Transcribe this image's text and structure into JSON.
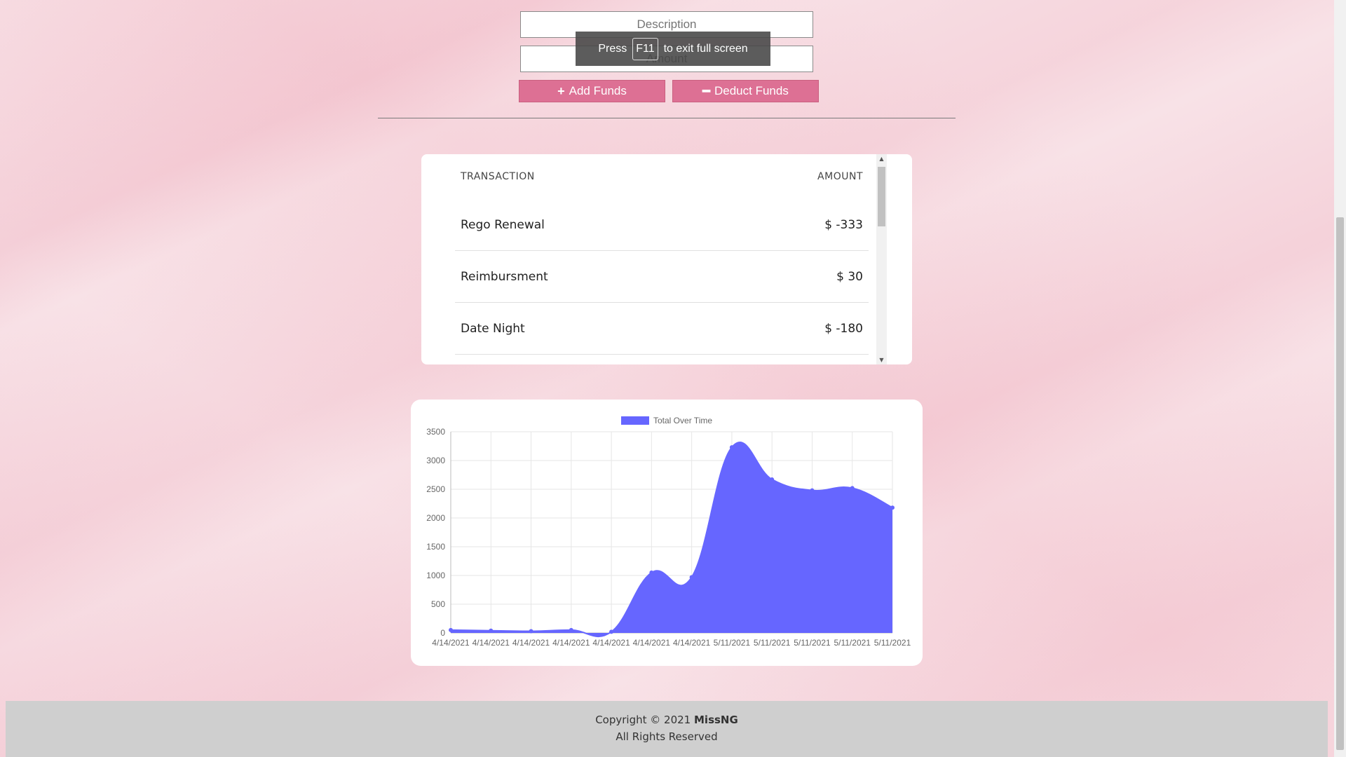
{
  "form": {
    "description_placeholder": "Description",
    "amount_placeholder": "Amount",
    "add_label": "Add Funds",
    "deduct_label": "Deduct Funds",
    "add_icon": "plus-icon",
    "deduct_icon": "minus-icon"
  },
  "fullscreen_notice": {
    "before": "Press",
    "key": "F11",
    "after": "to exit full screen"
  },
  "transactions": {
    "header": {
      "name": "TRANSACTION",
      "amount": "AMOUNT"
    },
    "rows": [
      {
        "name": "Rego Renewal",
        "amount": "$ -333"
      },
      {
        "name": "Reimbursment",
        "amount": "$ 30"
      },
      {
        "name": "Date Night",
        "amount": "$ -180"
      }
    ]
  },
  "chart_data": {
    "type": "area",
    "legend": [
      "Total Over Time"
    ],
    "series": [
      {
        "name": "Total Over Time",
        "color": "#6666ff",
        "values": [
          50,
          40,
          30,
          50,
          20,
          1050,
          970,
          3230,
          2670,
          2480,
          2520,
          2180
        ]
      }
    ],
    "x": [
      "4/14/2021",
      "4/14/2021",
      "4/14/2021",
      "4/14/2021",
      "4/14/2021",
      "4/14/2021",
      "4/14/2021",
      "5/11/2021",
      "5/11/2021",
      "5/11/2021",
      "5/11/2021",
      "5/11/2021"
    ],
    "yticks": [
      0,
      500,
      1000,
      1500,
      2000,
      2500,
      3000,
      3500
    ],
    "ylim": [
      0,
      3500
    ],
    "grid": true,
    "legend_position": "top"
  },
  "footer": {
    "copyright_prefix": "Copyright © 2021",
    "brand": "MissNG",
    "rights": "All Rights Reserved"
  }
}
